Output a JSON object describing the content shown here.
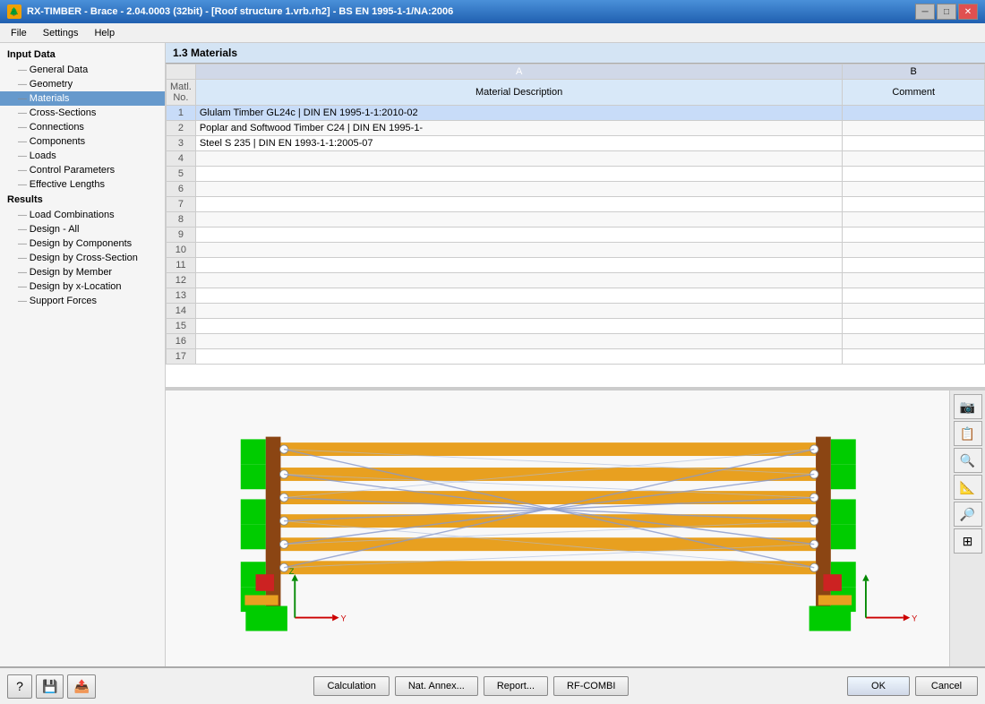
{
  "titleBar": {
    "title": "RX-TIMBER - Brace - 2.04.0003 (32bit) - [Roof structure 1.vrb.rh2] - BS EN 1995-1-1/NA:2006",
    "icon": "🌲"
  },
  "menuBar": {
    "items": [
      "File",
      "Settings",
      "Help"
    ]
  },
  "sidebar": {
    "sections": [
      {
        "label": "Input Data",
        "items": [
          {
            "label": "General Data",
            "active": false
          },
          {
            "label": "Geometry",
            "active": false
          },
          {
            "label": "Materials",
            "active": true
          },
          {
            "label": "Cross-Sections",
            "active": false
          },
          {
            "label": "Connections",
            "active": false
          },
          {
            "label": "Components",
            "active": false
          },
          {
            "label": "Loads",
            "active": false
          },
          {
            "label": "Control Parameters",
            "active": false
          },
          {
            "label": "Effective Lengths",
            "active": false
          }
        ]
      },
      {
        "label": "Results",
        "items": [
          {
            "label": "Load Combinations",
            "active": false
          },
          {
            "label": "Design - All",
            "active": false
          },
          {
            "label": "Design by Components",
            "active": false
          },
          {
            "label": "Design by Cross-Section",
            "active": false
          },
          {
            "label": "Design by Member",
            "active": false
          },
          {
            "label": "Design by x-Location",
            "active": false
          },
          {
            "label": "Support Forces",
            "active": false
          }
        ]
      }
    ]
  },
  "tablePanel": {
    "title": "1.3 Materials",
    "columnA": "A",
    "columnB": "B",
    "subRowNum": "Matl. No.",
    "subColA": "Material Description",
    "subColB": "Comment",
    "rows": [
      {
        "num": 1,
        "matl": "Glulam Timber GL24c | DIN EN 1995-1-1:2010-02",
        "comment": "",
        "selected": true
      },
      {
        "num": 2,
        "matl": "Poplar and Softwood Timber C24 | DIN EN 1995-1-",
        "comment": "",
        "selected": false
      },
      {
        "num": 3,
        "matl": "Steel S 235 | DIN EN 1993-1-1:2005-07",
        "comment": "",
        "selected": false
      },
      {
        "num": 4,
        "matl": "",
        "comment": "",
        "selected": false
      },
      {
        "num": 5,
        "matl": "",
        "comment": "",
        "selected": false
      },
      {
        "num": 6,
        "matl": "",
        "comment": "",
        "selected": false
      },
      {
        "num": 7,
        "matl": "",
        "comment": "",
        "selected": false
      },
      {
        "num": 8,
        "matl": "",
        "comment": "",
        "selected": false
      },
      {
        "num": 9,
        "matl": "",
        "comment": "",
        "selected": false
      },
      {
        "num": 10,
        "matl": "",
        "comment": "",
        "selected": false
      },
      {
        "num": 11,
        "matl": "",
        "comment": "",
        "selected": false
      },
      {
        "num": 12,
        "matl": "",
        "comment": "",
        "selected": false
      },
      {
        "num": 13,
        "matl": "",
        "comment": "",
        "selected": false
      },
      {
        "num": 14,
        "matl": "",
        "comment": "",
        "selected": false
      },
      {
        "num": 15,
        "matl": "",
        "comment": "",
        "selected": false
      },
      {
        "num": 16,
        "matl": "",
        "comment": "",
        "selected": false
      },
      {
        "num": 17,
        "matl": "",
        "comment": "",
        "selected": false
      }
    ]
  },
  "vizToolbar": {
    "buttons": [
      "📷",
      "📋",
      "🔍",
      "📐",
      "🔎",
      "⊞"
    ]
  },
  "bottomBar": {
    "leftButtons": [
      "❓",
      "💾",
      "📤"
    ],
    "centerButtons": [
      "Calculation",
      "Nat. Annex...",
      "Report...",
      "RF-COMBI"
    ],
    "rightButtons": [
      "OK",
      "Cancel"
    ]
  },
  "colors": {
    "accent": "#5588cc",
    "headerBg": "#d4e4f4",
    "activeSidebar": "#6699cc",
    "beamColor": "#e8a020",
    "supportColor": "#00cc00",
    "connectorColor": "#8b4513"
  }
}
